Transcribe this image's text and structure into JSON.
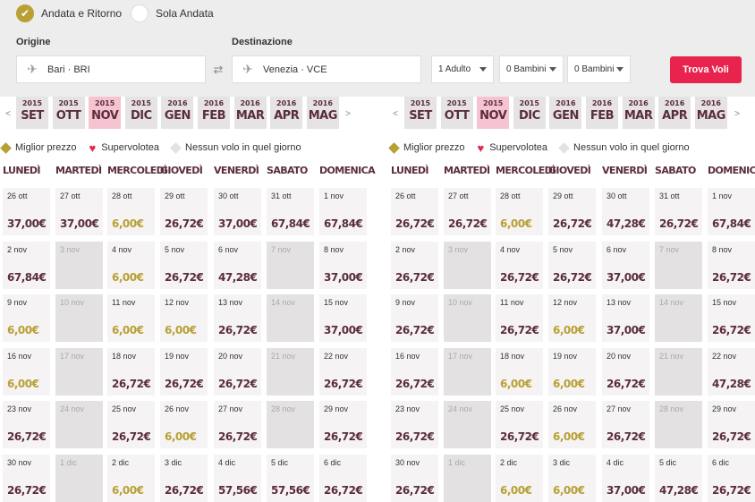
{
  "trip": {
    "roundtrip": "Andata e Ritorno",
    "oneway": "Sola Andata"
  },
  "origin": {
    "label": "Origine",
    "value": "Bari · BRI"
  },
  "destination": {
    "label": "Destinazione",
    "value": "Venezia · VCE"
  },
  "passengers": {
    "adults": "1 Adulto",
    "children": "0 Bambini",
    "infants": "0 Bambini"
  },
  "search_button": "Trova Voli",
  "months": [
    {
      "year": "2015",
      "name": "SET",
      "active": false
    },
    {
      "year": "2015",
      "name": "OTT",
      "active": false
    },
    {
      "year": "2015",
      "name": "NOV",
      "active": true
    },
    {
      "year": "2015",
      "name": "DIC",
      "active": false
    },
    {
      "year": "2016",
      "name": "GEN",
      "active": false
    },
    {
      "year": "2016",
      "name": "FEB",
      "active": false
    },
    {
      "year": "2016",
      "name": "MAR",
      "active": false
    },
    {
      "year": "2016",
      "name": "APR",
      "active": false
    },
    {
      "year": "2016",
      "name": "MAG",
      "active": false
    }
  ],
  "nav": {
    "prev": "<",
    "next": ">"
  },
  "legend": {
    "best": "Miglior prezzo",
    "super": "Supervolotea",
    "none": "Nessun volo in quel giorno"
  },
  "colors": {
    "accent": "#e8234e",
    "gold": "#b8a034",
    "brand": "#5b2d3a"
  },
  "weekdays": [
    "LUNEDÌ",
    "MARTEDÌ",
    "MERCOLEDÌ",
    "GIOVEDÌ",
    "VENERDÌ",
    "SABATO",
    "DOMENICA"
  ],
  "outbound": [
    [
      {
        "date": "26 ott",
        "price": "37,00€"
      },
      {
        "date": "27 ott",
        "price": "37,00€"
      },
      {
        "date": "28 ott",
        "price": "6,00€",
        "low": true
      },
      {
        "date": "29 ott",
        "price": "26,72€"
      },
      {
        "date": "30 ott",
        "price": "37,00€"
      },
      {
        "date": "31 ott",
        "price": "67,84€"
      },
      {
        "date": "1 nov",
        "price": "67,84€"
      }
    ],
    [
      {
        "date": "2 nov",
        "price": "67,84€"
      },
      {
        "date": "3 nov",
        "price": ""
      },
      {
        "date": "4 nov",
        "price": "6,00€",
        "low": true
      },
      {
        "date": "5 nov",
        "price": "26,72€"
      },
      {
        "date": "6 nov",
        "price": "47,28€"
      },
      {
        "date": "7 nov",
        "price": ""
      },
      {
        "date": "8 nov",
        "price": "37,00€"
      }
    ],
    [
      {
        "date": "9 nov",
        "price": "6,00€",
        "low": true
      },
      {
        "date": "10 nov",
        "price": ""
      },
      {
        "date": "11 nov",
        "price": "6,00€",
        "low": true
      },
      {
        "date": "12 nov",
        "price": "6,00€",
        "low": true
      },
      {
        "date": "13 nov",
        "price": "26,72€"
      },
      {
        "date": "14 nov",
        "price": ""
      },
      {
        "date": "15 nov",
        "price": "37,00€"
      }
    ],
    [
      {
        "date": "16 nov",
        "price": "6,00€",
        "low": true
      },
      {
        "date": "17 nov",
        "price": ""
      },
      {
        "date": "18 nov",
        "price": "26,72€"
      },
      {
        "date": "19 nov",
        "price": "26,72€"
      },
      {
        "date": "20 nov",
        "price": "26,72€"
      },
      {
        "date": "21 nov",
        "price": ""
      },
      {
        "date": "22 nov",
        "price": "26,72€"
      }
    ],
    [
      {
        "date": "23 nov",
        "price": "26,72€"
      },
      {
        "date": "24 nov",
        "price": ""
      },
      {
        "date": "25 nov",
        "price": "26,72€"
      },
      {
        "date": "26 nov",
        "price": "6,00€",
        "low": true
      },
      {
        "date": "27 nov",
        "price": "26,72€"
      },
      {
        "date": "28 nov",
        "price": ""
      },
      {
        "date": "29 nov",
        "price": "26,72€"
      }
    ],
    [
      {
        "date": "30 nov",
        "price": "26,72€"
      },
      {
        "date": "1 dic",
        "price": ""
      },
      {
        "date": "2 dic",
        "price": "6,00€",
        "low": true
      },
      {
        "date": "3 dic",
        "price": "26,72€"
      },
      {
        "date": "4 dic",
        "price": "57,56€"
      },
      {
        "date": "5 dic",
        "price": "57,56€"
      },
      {
        "date": "6 dic",
        "price": "26,72€"
      }
    ]
  ],
  "return": [
    [
      {
        "date": "26 ott",
        "price": "26,72€"
      },
      {
        "date": "27 ott",
        "price": "26,72€"
      },
      {
        "date": "28 ott",
        "price": "6,00€",
        "low": true
      },
      {
        "date": "29 ott",
        "price": "26,72€"
      },
      {
        "date": "30 ott",
        "price": "47,28€"
      },
      {
        "date": "31 ott",
        "price": "26,72€"
      },
      {
        "date": "1 nov",
        "price": "67,84€"
      }
    ],
    [
      {
        "date": "2 nov",
        "price": "26,72€"
      },
      {
        "date": "3 nov",
        "price": ""
      },
      {
        "date": "4 nov",
        "price": "26,72€"
      },
      {
        "date": "5 nov",
        "price": "26,72€"
      },
      {
        "date": "6 nov",
        "price": "37,00€"
      },
      {
        "date": "7 nov",
        "price": ""
      },
      {
        "date": "8 nov",
        "price": "26,72€"
      }
    ],
    [
      {
        "date": "9 nov",
        "price": "26,72€"
      },
      {
        "date": "10 nov",
        "price": ""
      },
      {
        "date": "11 nov",
        "price": "26,72€"
      },
      {
        "date": "12 nov",
        "price": "6,00€",
        "low": true
      },
      {
        "date": "13 nov",
        "price": "37,00€"
      },
      {
        "date": "14 nov",
        "price": ""
      },
      {
        "date": "15 nov",
        "price": "26,72€"
      }
    ],
    [
      {
        "date": "16 nov",
        "price": "26,72€"
      },
      {
        "date": "17 nov",
        "price": ""
      },
      {
        "date": "18 nov",
        "price": "6,00€",
        "low": true
      },
      {
        "date": "19 nov",
        "price": "6,00€",
        "low": true
      },
      {
        "date": "20 nov",
        "price": "26,72€"
      },
      {
        "date": "21 nov",
        "price": ""
      },
      {
        "date": "22 nov",
        "price": "47,28€"
      }
    ],
    [
      {
        "date": "23 nov",
        "price": "26,72€"
      },
      {
        "date": "24 nov",
        "price": ""
      },
      {
        "date": "25 nov",
        "price": "26,72€"
      },
      {
        "date": "26 nov",
        "price": "6,00€",
        "low": true
      },
      {
        "date": "27 nov",
        "price": "26,72€"
      },
      {
        "date": "28 nov",
        "price": ""
      },
      {
        "date": "29 nov",
        "price": "26,72€"
      }
    ],
    [
      {
        "date": "30 nov",
        "price": "26,72€"
      },
      {
        "date": "1 dic",
        "price": ""
      },
      {
        "date": "2 dic",
        "price": "6,00€",
        "low": true
      },
      {
        "date": "3 dic",
        "price": "6,00€",
        "low": true
      },
      {
        "date": "4 dic",
        "price": "37,00€"
      },
      {
        "date": "5 dic",
        "price": "47,28€"
      },
      {
        "date": "6 dic",
        "price": "26,72€"
      }
    ]
  ]
}
